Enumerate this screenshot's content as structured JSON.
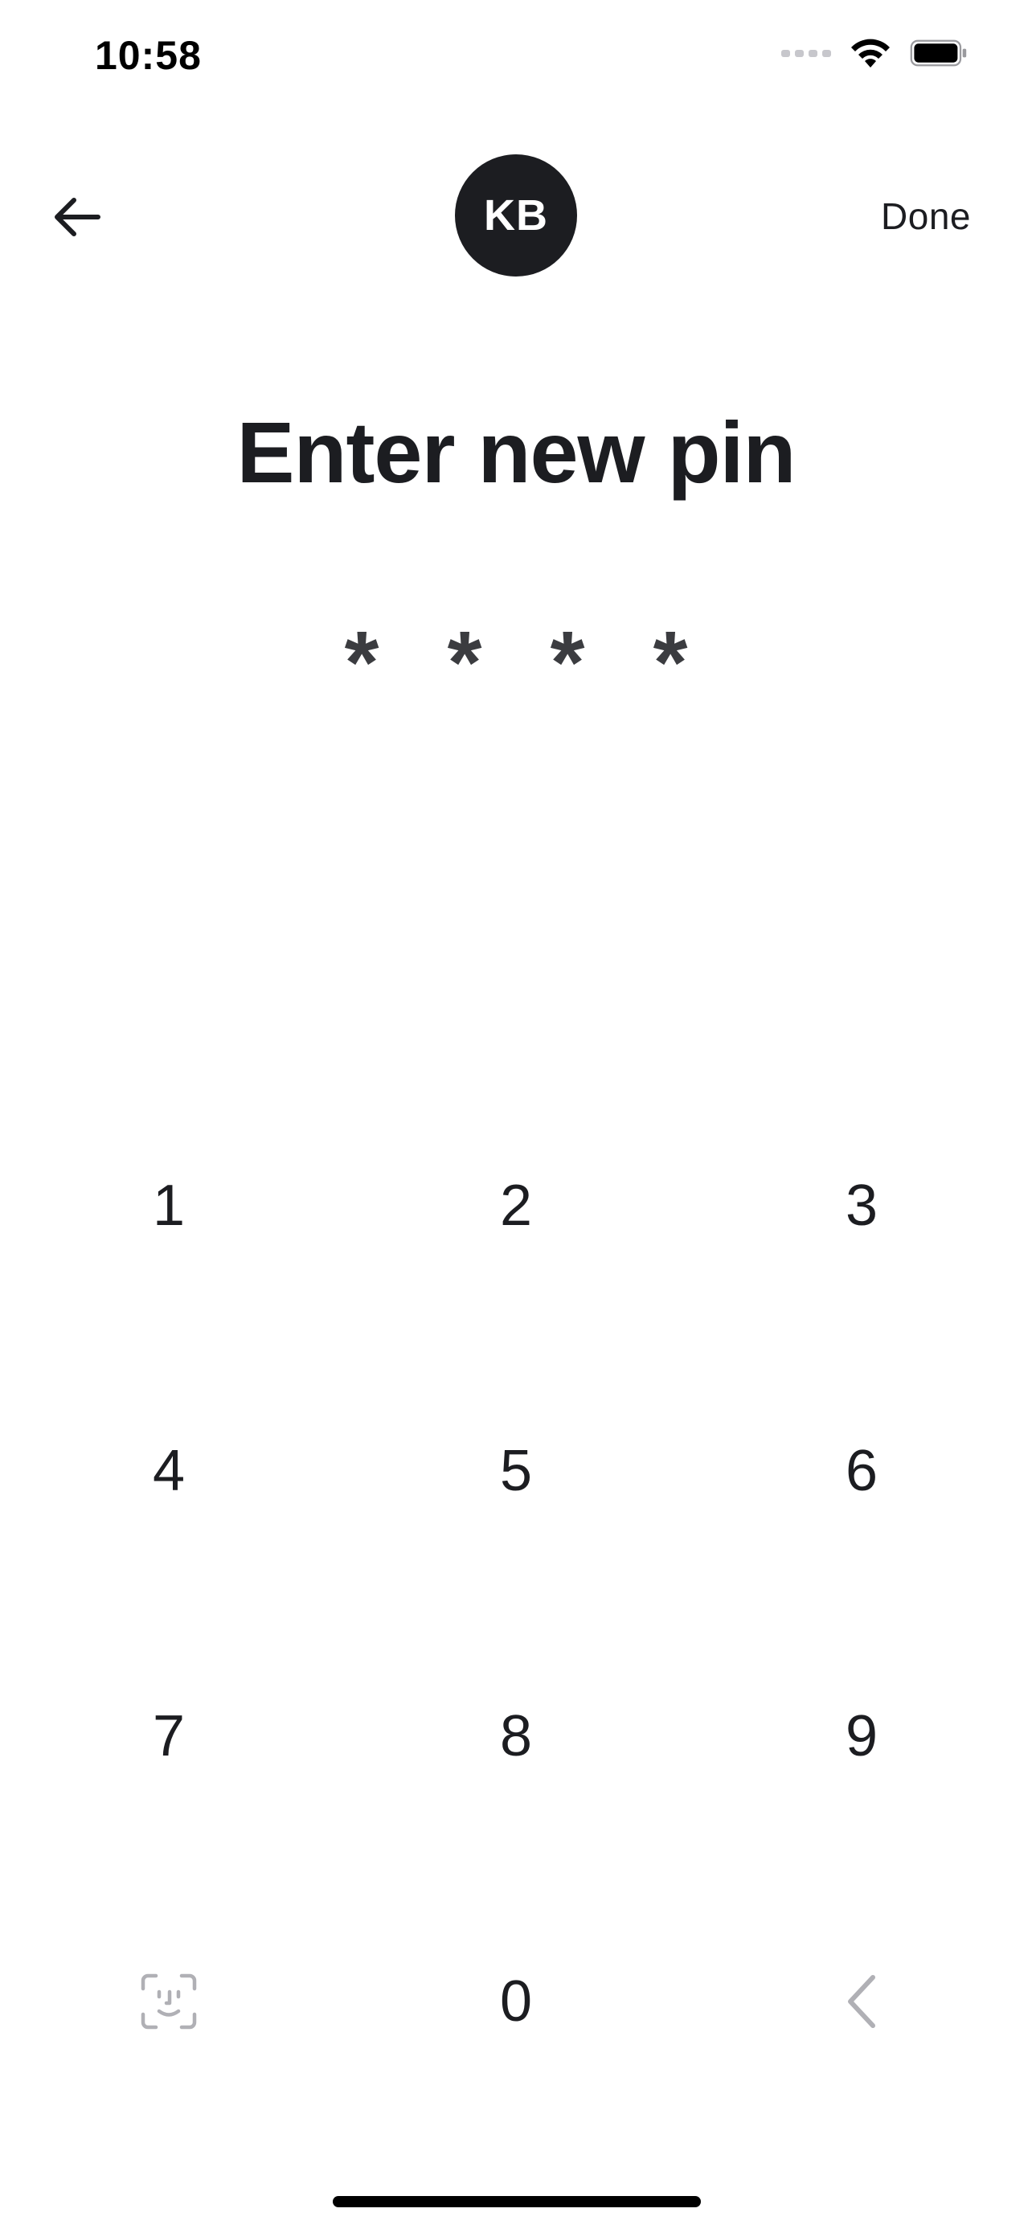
{
  "status_bar": {
    "time": "10:58",
    "icons": [
      "signal-icon",
      "wifi-icon",
      "battery-icon"
    ]
  },
  "header": {
    "back_icon": "arrow-left-icon",
    "avatar_initials": "KB",
    "done_label": "Done"
  },
  "title": "Enter new pin",
  "pin": {
    "chars": [
      "*",
      "*",
      "*",
      "*"
    ]
  },
  "keypad": {
    "keys": [
      "1",
      "2",
      "3",
      "4",
      "5",
      "6",
      "7",
      "8",
      "9",
      "0"
    ],
    "biometric_icon": "face-id-icon",
    "delete_icon": "chevron-left-icon"
  },
  "colors": {
    "text": "#1c1d21",
    "avatar_bg": "#1c1d21",
    "icon_muted": "#b0b0b5",
    "background": "#ffffff"
  }
}
